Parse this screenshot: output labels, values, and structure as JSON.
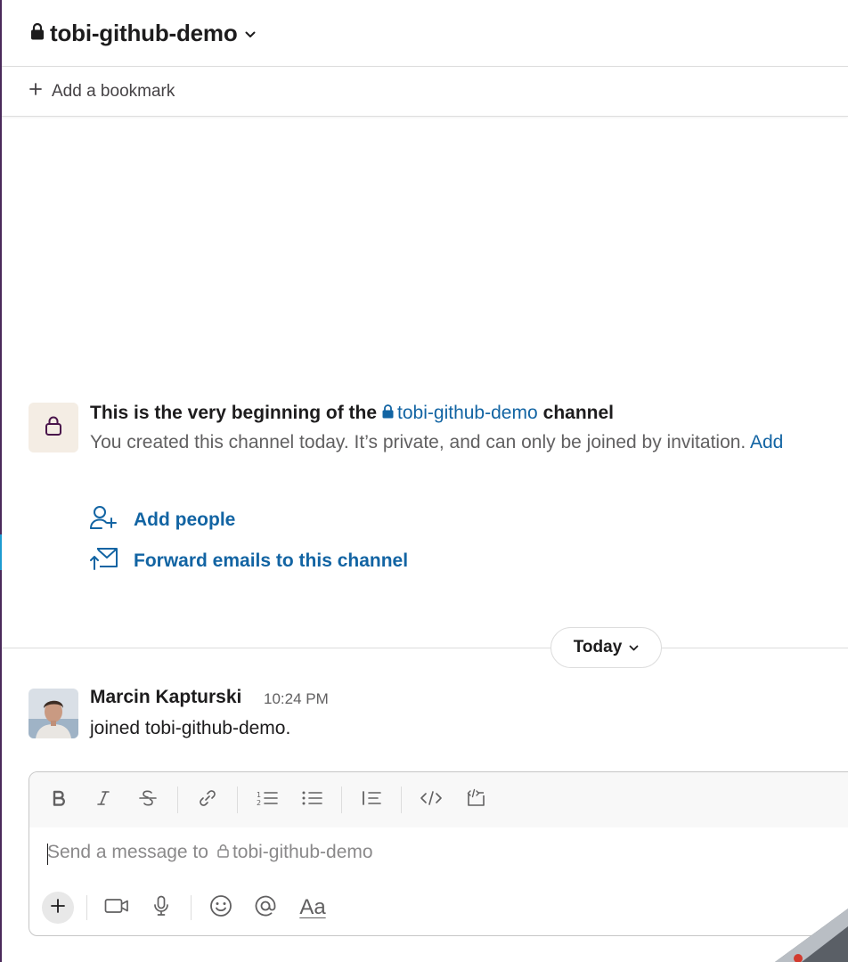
{
  "header": {
    "channel_name": "tobi-github-demo"
  },
  "bookmarks": {
    "add_label": "Add a bookmark"
  },
  "intro": {
    "title_prefix": "This is the very beginning of the",
    "title_channel": "tobi-github-demo",
    "title_suffix": "channel",
    "description": "You created this channel today. It’s private, and can only be joined by invitation.",
    "description_link": "Add"
  },
  "actions": {
    "add_people": "Add people",
    "forward_emails": "Forward emails to this channel"
  },
  "divider": {
    "label": "Today"
  },
  "message": {
    "author": "Marcin Kapturski",
    "time": "10:24 PM",
    "text": "joined tobi-github-demo."
  },
  "composer": {
    "placeholder_prefix": "Send a message to",
    "placeholder_channel": "tobi-github-demo",
    "text_format_label": "Aa"
  },
  "colors": {
    "link": "#1264a3",
    "text": "#1d1c1d",
    "muted": "#616061",
    "lock_box": "#f4ede4"
  },
  "icons": [
    "lock-icon",
    "chevron-down-icon",
    "plus-icon",
    "add-person-icon",
    "forward-email-icon",
    "bold-icon",
    "italic-icon",
    "strikethrough-icon",
    "link-icon",
    "ordered-list-icon",
    "bulleted-list-icon",
    "blockquote-icon",
    "code-icon",
    "code-block-icon",
    "video-icon",
    "microphone-icon",
    "emoji-icon",
    "mention-icon"
  ]
}
